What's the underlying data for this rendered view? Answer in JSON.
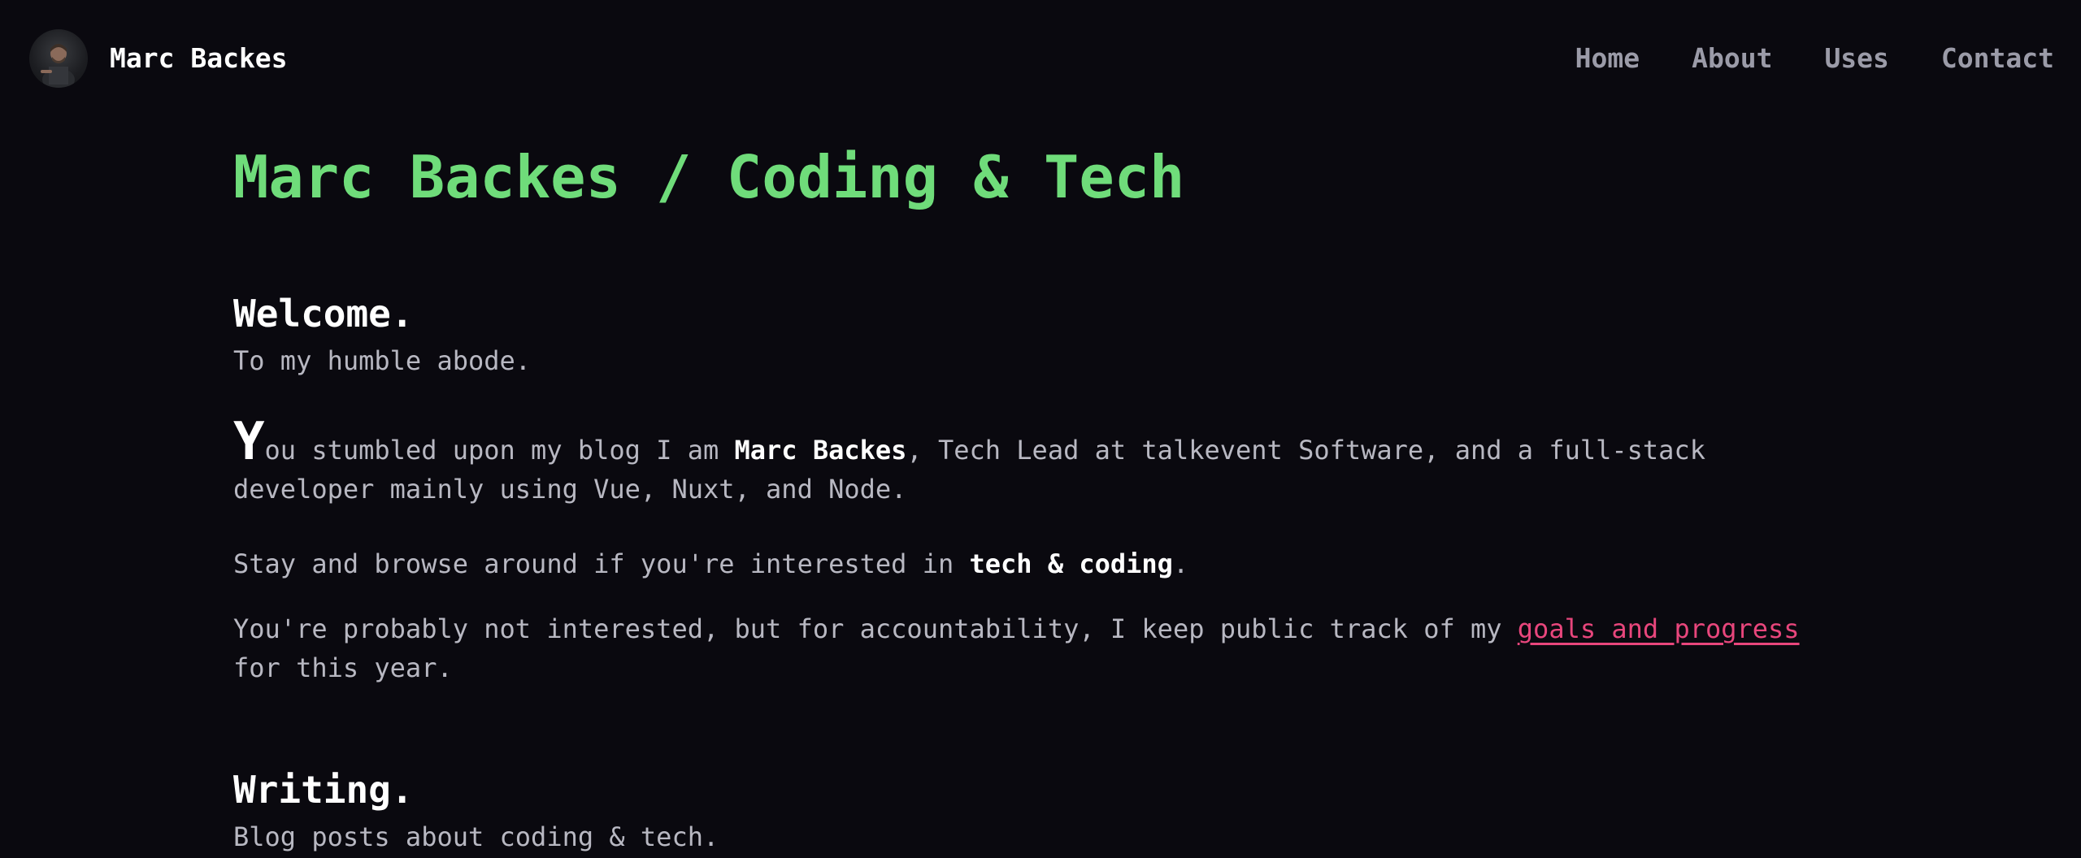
{
  "header": {
    "brand": "Marc Backes",
    "nav": [
      "Home",
      "About",
      "Uses",
      "Contact"
    ]
  },
  "main": {
    "title": "Marc Backes / Coding & Tech",
    "welcome": {
      "heading": "Welcome.",
      "sub": "To my humble abode."
    },
    "intro": {
      "dropcap": "Y",
      "part1": "ou stumbled upon my blog I am ",
      "name": "Marc Backes",
      "part2": ", Tech Lead at talkevent Software, and a full-stack developer mainly using Vue, Nuxt, and Node."
    },
    "browse": {
      "part1": "Stay and browse around if you're interested in ",
      "emphasis": "tech & coding",
      "part2": "."
    },
    "goals": {
      "part1": "You're probably not interested, but for accountability, I keep public track of my ",
      "link": "goals and progress",
      "part2": " for this year."
    },
    "writing": {
      "heading": "Writing.",
      "sub": "Blog posts about coding & tech."
    }
  },
  "colors": {
    "background": "#0a090f",
    "accent_green": "#6fdc7a",
    "link_pink": "#e8467c",
    "text": "#b8b8c2",
    "nav": "#9b9ba8"
  }
}
